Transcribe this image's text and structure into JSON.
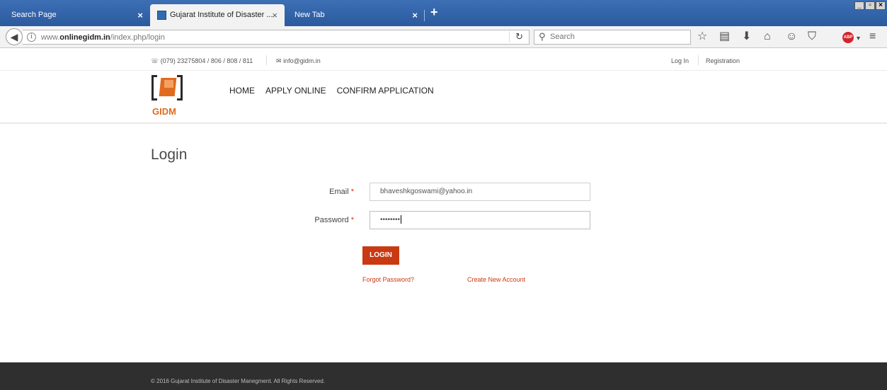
{
  "browser": {
    "tabs": [
      {
        "label": "Search Page"
      },
      {
        "label": "Gujarat Institute of Disaster ...",
        "active": true
      },
      {
        "label": "New Tab"
      }
    ],
    "url_prefix": "www.",
    "url_domain": "onlinegidm.in",
    "url_path": "/index.php/login",
    "search_placeholder": "Search",
    "icons": [
      "bookmark-star-icon",
      "reading-list-icon",
      "download-icon",
      "home-icon",
      "chat-icon",
      "pocket-icon",
      "adblock-plus-icon",
      "menu-icon"
    ],
    "adblock_label": "ABP"
  },
  "topinfo": {
    "phone": "(079) 23275804 / 806 / 808 / 811",
    "email": "info@gidm.in",
    "login": "Log In",
    "registration": "Registration"
  },
  "header": {
    "logo_text": "GIDM",
    "menu": [
      "HOME",
      "APPLY ONLINE",
      "CONFIRM APPLICATION"
    ]
  },
  "main": {
    "title": "Login",
    "email_label": "Email",
    "email_value": "bhaveshkgoswami@yahoo.in",
    "password_label": "Password",
    "password_value": "••••••••",
    "required_marker": "*",
    "login_button": "LOGIN",
    "forgot_password": "Forgot Password?",
    "create_account": "Create New Account"
  },
  "footer": {
    "copyright": "© 2016 Gujarat Institute of Disaster Manegment. All Rights Reserved."
  },
  "colors": {
    "accent": "#c93a12",
    "logo_orange": "#e06b1f",
    "footer_bg": "#2f2f2f",
    "tabbar_bg": "#2b5a9e"
  }
}
